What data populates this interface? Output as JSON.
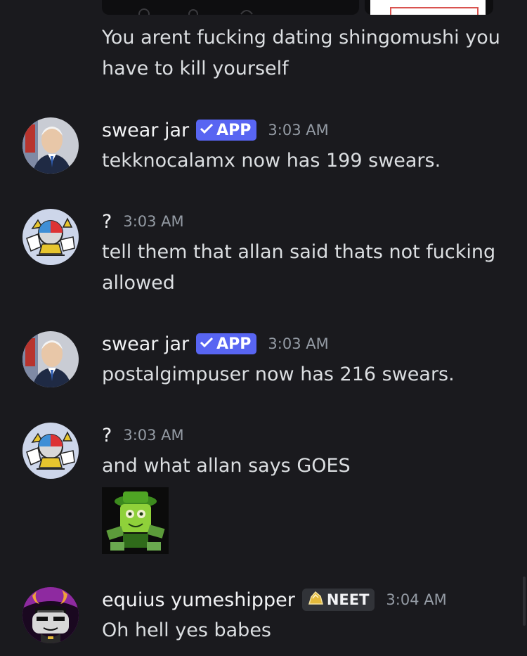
{
  "colors": {
    "background": "#1a1a1e",
    "text": "#dbdee1",
    "username": "#f2f3f5",
    "timestamp": "#949ba4",
    "app_badge": "#5865f2"
  },
  "messages": [
    {
      "id": "continuation",
      "text": "You arent fucking dating shingomushi you have to kill yourself"
    },
    {
      "id": "swear-jar-1",
      "author": "swear jar",
      "badge": "APP",
      "timestamp": "3:03 AM",
      "text": "tekknocalamx now has 199 swears."
    },
    {
      "id": "question-1",
      "author": "?",
      "timestamp": "3:03 AM",
      "text": "tell them that allan said thats not fucking allowed"
    },
    {
      "id": "swear-jar-2",
      "author": "swear jar",
      "badge": "APP",
      "timestamp": "3:03 AM",
      "text": "postalgimpuser now has 216 swears."
    },
    {
      "id": "question-2",
      "author": "?",
      "timestamp": "3:03 AM",
      "text": "and what allan says GOES",
      "attachment_icon": "green-sponge-sticker"
    },
    {
      "id": "equius",
      "author": "equius yumeshipper",
      "badge": "NEET",
      "badge_icon": "gold-nugget-icon",
      "timestamp": "3:04 AM",
      "text": "Oh hell yes babes"
    }
  ]
}
